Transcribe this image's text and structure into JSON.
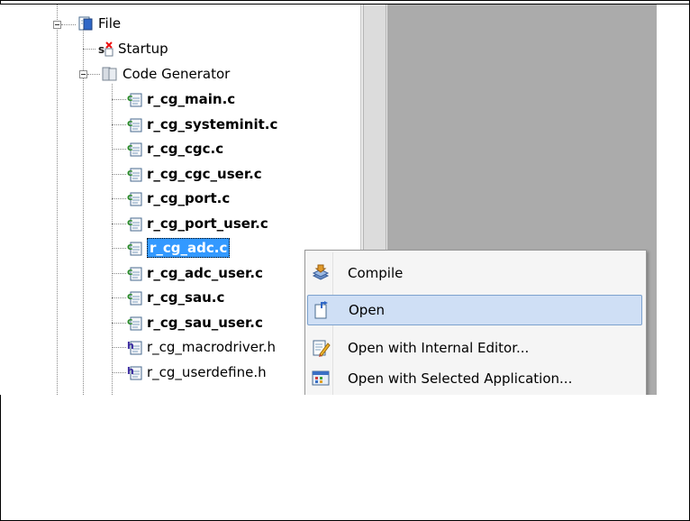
{
  "tree": {
    "root_label": "File",
    "items": [
      {
        "label": "Startup",
        "kind": "startup"
      },
      {
        "label": "Code Generator",
        "kind": "folder"
      }
    ],
    "files": [
      {
        "label": "r_cg_main.c",
        "kind": "c",
        "bold": true
      },
      {
        "label": "r_cg_systeminit.c",
        "kind": "c",
        "bold": true
      },
      {
        "label": "r_cg_cgc.c",
        "kind": "c",
        "bold": true
      },
      {
        "label": "r_cg_cgc_user.c",
        "kind": "c",
        "bold": true
      },
      {
        "label": "r_cg_port.c",
        "kind": "c",
        "bold": true
      },
      {
        "label": "r_cg_port_user.c",
        "kind": "c",
        "bold": true
      },
      {
        "label": "r_cg_adc.c",
        "kind": "c",
        "bold": true,
        "selected": true
      },
      {
        "label": "r_cg_adc_user.c",
        "kind": "c",
        "bold": true
      },
      {
        "label": "r_cg_sau.c",
        "kind": "c",
        "bold": true
      },
      {
        "label": "r_cg_sau_user.c",
        "kind": "c",
        "bold": true
      },
      {
        "label": "r_cg_macrodriver.h",
        "kind": "h",
        "bold": false
      },
      {
        "label": "r_cg_userdefine.h",
        "kind": "h",
        "bold": false
      }
    ]
  },
  "context_menu": {
    "items": [
      {
        "label": "Compile",
        "icon": "compile-icon"
      },
      {
        "label": "Open",
        "icon": "open-icon",
        "highlighted": true
      },
      {
        "label": "Open with Internal Editor...",
        "icon": "internal-editor-icon"
      },
      {
        "label": "Open with Selected Application...",
        "icon": "selected-application-icon"
      }
    ]
  },
  "colors": {
    "selection": "#3399ff",
    "menu_highlight": "#cfdff5",
    "editor_background": "#ababab"
  }
}
